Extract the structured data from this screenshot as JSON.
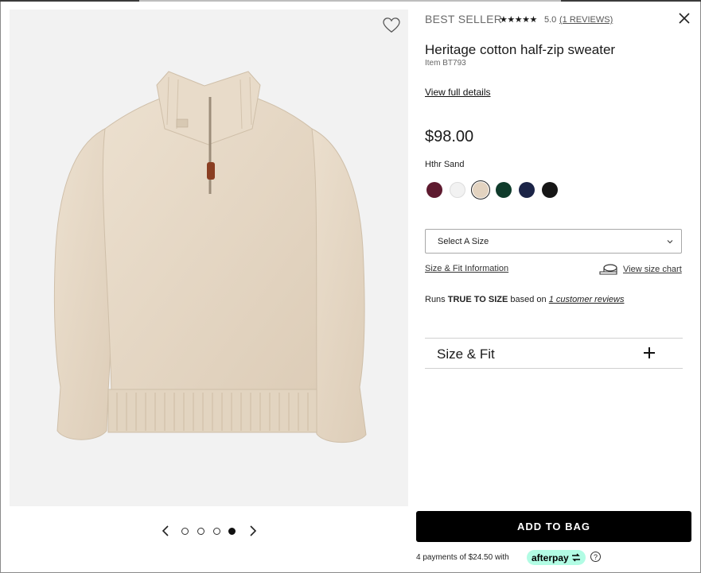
{
  "product": {
    "badge": "BEST SELLER",
    "stars": "★★★★★",
    "rating": "5.0",
    "reviews_link": "(1 REVIEWS)",
    "title": "Heritage cotton half-zip sweater",
    "item_number": "Item BT793",
    "details_link": "View full details",
    "price": "$98.00",
    "color_name": "Hthr Sand",
    "swatches": [
      {
        "name": "burgundy",
        "color": "#5e1a2f"
      },
      {
        "name": "white",
        "color": "#f2f2f2"
      },
      {
        "name": "sand",
        "color": "#e3d3c0",
        "selected": true
      },
      {
        "name": "green",
        "color": "#0f3b2b"
      },
      {
        "name": "navy",
        "color": "#1b2447"
      },
      {
        "name": "black",
        "color": "#161616"
      }
    ]
  },
  "size": {
    "select_label": "Select A Size",
    "fit_info_link": "Size & Fit Information",
    "chart_link": "View size chart",
    "runs_prefix": "Runs ",
    "runs_bold": "TRUE TO SIZE",
    "runs_mid": " based on ",
    "runs_link": "1 customer reviews"
  },
  "accordion": {
    "size_fit_label": "Size & Fit"
  },
  "gallery": {
    "dots": 4,
    "active_index": 3
  },
  "cart": {
    "add_to_bag": "ADD TO BAG",
    "payments_text": "4 payments of $24.50 with",
    "afterpay_label": "afterpay",
    "help": "?"
  },
  "colors": {
    "image_bg": "#f2f2f2",
    "sweater": "#e6d8c5",
    "afterpay_mint": "#b2fce4",
    "button_bg": "#000000"
  }
}
